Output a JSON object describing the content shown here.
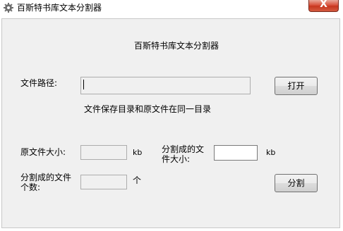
{
  "window": {
    "title": "百斯特书库文本分割器",
    "close_label": "X"
  },
  "main": {
    "heading": "百斯特书库文本分割器",
    "path_label": "文件路径:",
    "path_value": "",
    "open_button": "打开",
    "note": "文件保存目录和原文件在同一目录",
    "size_label": "原文件大小:",
    "size_value": "",
    "size_unit": "kb",
    "split_size_label": "分割成的文件大小:",
    "split_size_value": "",
    "split_size_unit": "kb",
    "split_count_label": "分割成的文件个数:",
    "split_count_value": "",
    "split_count_unit": "个",
    "split_button": "分割"
  }
}
